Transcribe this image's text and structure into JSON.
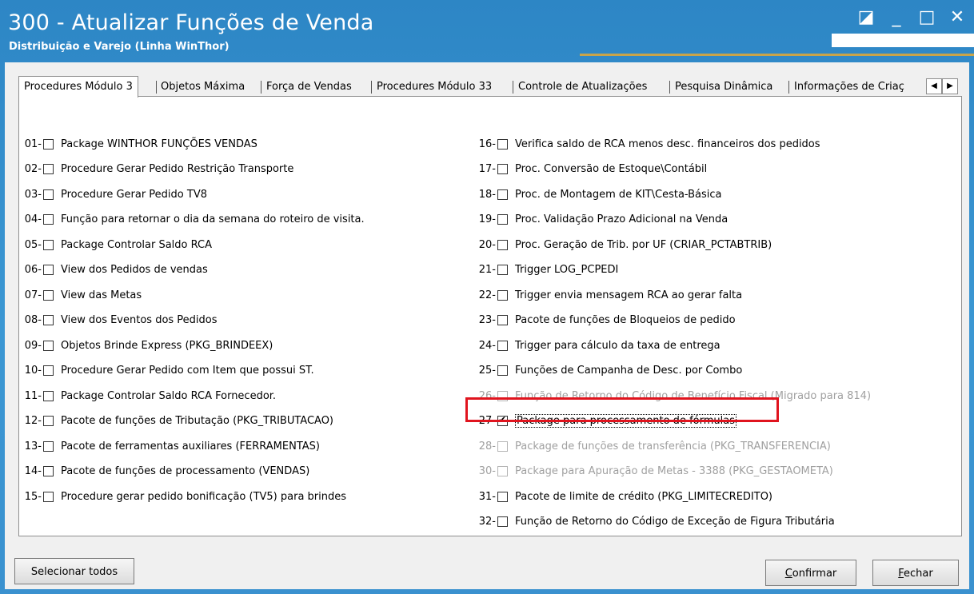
{
  "window": {
    "title": "300 - Atualizar Funções de Venda",
    "subtitle": "Distribuição e Varejo (Linha WinThor)",
    "controls": [
      "◪",
      "_",
      "□",
      "✕"
    ]
  },
  "tabs": [
    "Procedures Módulo 3",
    "Objetos Máxima",
    "Força de Vendas",
    "Procedures Módulo 33",
    "Controle de Atualizações",
    "Pesquisa Dinâmica",
    "Informações de Criaç"
  ],
  "tab_scroll": {
    "left": "◀",
    "right": "▶"
  },
  "left_items": [
    {
      "num": "01-",
      "label": "Package WINTHOR FUNÇÕES VENDAS"
    },
    {
      "num": "02-",
      "label": "Procedure Gerar Pedido Restrição Transporte"
    },
    {
      "num": "03-",
      "label": "Procedure Gerar Pedido TV8"
    },
    {
      "num": "04-",
      "label": "Função para retornar o dia da semana do roteiro de visita."
    },
    {
      "num": "05-",
      "label": "Package Controlar Saldo RCA"
    },
    {
      "num": "06-",
      "label": "View dos Pedidos de vendas"
    },
    {
      "num": "07-",
      "label": "View das Metas"
    },
    {
      "num": "08-",
      "label": "View dos Eventos dos Pedidos"
    },
    {
      "num": "09-",
      "label": "Objetos Brinde Express (PKG_BRINDEEX)"
    },
    {
      "num": "10-",
      "label": "Procedure Gerar Pedido com Item que possui ST."
    },
    {
      "num": "11-",
      "label": "Package Controlar Saldo RCA Fornecedor."
    },
    {
      "num": "12-",
      "label": "Pacote de funções de Tributação (PKG_TRIBUTACAO)"
    },
    {
      "num": "13-",
      "label": "Pacote de ferramentas auxiliares (FERRAMENTAS)"
    },
    {
      "num": "14-",
      "label": "Pacote de funções de processamento (VENDAS)"
    },
    {
      "num": "15-",
      "label": "Procedure gerar pedido bonificação (TV5) para brindes"
    }
  ],
  "right_items": [
    {
      "num": "16-",
      "label": "Verifica saldo de RCA menos desc. financeiros dos pedidos"
    },
    {
      "num": "17-",
      "label": "Proc. Conversão de Estoque\\Contábil"
    },
    {
      "num": "18-",
      "label": "Proc. de Montagem de KIT\\Cesta-Básica"
    },
    {
      "num": "19-",
      "label": "Proc. Validação Prazo Adicional na Venda"
    },
    {
      "num": "20-",
      "label": "Proc. Geração de Trib. por UF (CRIAR_PCTABTRIB)"
    },
    {
      "num": "21-",
      "label": "Trigger LOG_PCPEDI"
    },
    {
      "num": "22-",
      "label": "Trigger envia mensagem RCA ao gerar falta"
    },
    {
      "num": "23-",
      "label": "Pacote de funções de Bloqueios de pedido"
    },
    {
      "num": "24-",
      "label": "Trigger para cálculo da taxa de entrega"
    },
    {
      "num": "25-",
      "label": "Funções de Campanha de Desc. por Combo"
    },
    {
      "num": "26-",
      "label": "Função de Retorno do Código de Benefício Fiscal (Migrado para 814)"
    },
    {
      "num": "27-",
      "label": "Package para processamento de fórmulas"
    },
    {
      "num": "28-",
      "label": "Package de funções de transferência (PKG_TRANSFERENCIA)"
    },
    {
      "num": "30-",
      "label": "Package para Apuração de Metas - 3388 (PKG_GESTAOMETA)"
    },
    {
      "num": "31-",
      "label": "Pacote de limite de crédito (PKG_LIMITECREDITO)"
    },
    {
      "num": "32-",
      "label": "Função de Retorno do Código de Exceção de Figura Tributária"
    }
  ],
  "buttons": {
    "select_all": "Selecionar todos",
    "confirm_first": "C",
    "confirm_rest": "onfirmar",
    "close_first": "F",
    "close_rest": "echar"
  }
}
